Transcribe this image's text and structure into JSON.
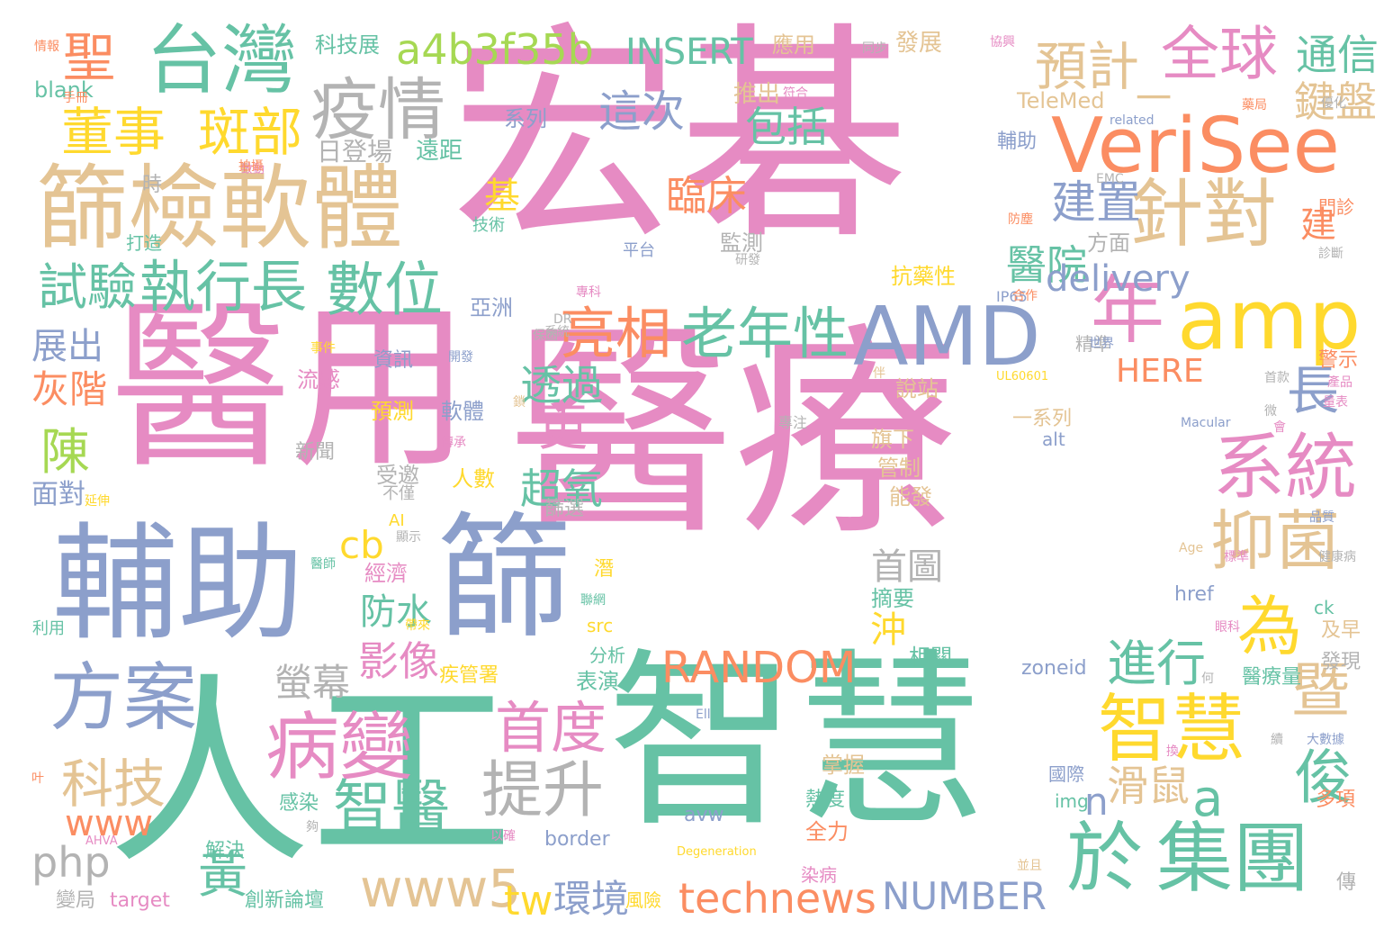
{
  "palette": {
    "pink": "#e68bc3",
    "blue": "#8c9fcb",
    "green": "#66c2a5",
    "orange": "#fb8d62",
    "tan": "#e4c494",
    "yellow": "#ffd92e",
    "lime": "#a6d853",
    "gray": "#b3b3b3"
  },
  "words": [
    {
      "text": "宏碁",
      "color": "pink"
    },
    {
      "text": "醫療",
      "color": "pink"
    },
    {
      "text": "醫用",
      "color": "pink"
    },
    {
      "text": "人工",
      "color": "green"
    },
    {
      "text": "智慧",
      "color": "green"
    },
    {
      "text": "輔助",
      "color": "blue"
    },
    {
      "text": "篩",
      "color": "blue"
    },
    {
      "text": "篩檢軟體",
      "color": "tan"
    },
    {
      "text": "台灣",
      "color": "green"
    },
    {
      "text": "疫情",
      "color": "gray"
    },
    {
      "text": "VeriSee",
      "color": "orange"
    },
    {
      "text": "amp",
      "color": "yellow"
    },
    {
      "text": "AMD",
      "color": "blue"
    },
    {
      "text": "針對",
      "color": "tan"
    },
    {
      "text": "全球",
      "color": "pink"
    },
    {
      "text": "一",
      "color": "tan"
    },
    {
      "text": "年",
      "color": "pink"
    },
    {
      "text": "系統",
      "color": "pink"
    },
    {
      "text": "抑菌",
      "color": "tan"
    },
    {
      "text": "為",
      "color": "yellow"
    },
    {
      "text": "智慧",
      "color": "yellow"
    },
    {
      "text": "暨",
      "color": "tan"
    },
    {
      "text": "於",
      "color": "green"
    },
    {
      "text": "集團",
      "color": "green"
    },
    {
      "text": "俊",
      "color": "green"
    },
    {
      "text": "方案",
      "color": "blue"
    },
    {
      "text": "病變",
      "color": "pink"
    },
    {
      "text": "智醫",
      "color": "green"
    },
    {
      "text": "首度",
      "color": "pink"
    },
    {
      "text": "提升",
      "color": "gray"
    },
    {
      "text": "科技",
      "color": "tan"
    },
    {
      "text": "www",
      "color": "orange"
    },
    {
      "text": "php",
      "color": "gray"
    },
    {
      "text": "黃",
      "color": "green"
    },
    {
      "text": "www5",
      "color": "tan"
    },
    {
      "text": "tw",
      "color": "yellow"
    },
    {
      "text": "環境",
      "color": "blue"
    },
    {
      "text": "technews",
      "color": "orange"
    },
    {
      "text": "NUMBER",
      "color": "blue"
    },
    {
      "text": "RANDOM",
      "color": "orange"
    },
    {
      "text": "螢幕",
      "color": "gray"
    },
    {
      "text": "影像",
      "color": "pink"
    },
    {
      "text": "進行",
      "color": "green"
    },
    {
      "text": "老年性",
      "color": "green"
    },
    {
      "text": "亮相",
      "color": "orange"
    },
    {
      "text": "數位",
      "color": "green"
    },
    {
      "text": "執行長",
      "color": "green"
    },
    {
      "text": "試驗",
      "color": "green"
    },
    {
      "text": "董事",
      "color": "yellow"
    },
    {
      "text": "斑部",
      "color": "yellow"
    },
    {
      "text": "聖",
      "color": "orange"
    },
    {
      "text": "a4b3f35b",
      "color": "lime"
    },
    {
      "text": "INSERT",
      "color": "green"
    },
    {
      "text": "預計",
      "color": "tan"
    },
    {
      "text": "通信",
      "color": "green"
    },
    {
      "text": "鍵盤",
      "color": "tan"
    },
    {
      "text": "包括",
      "color": "green"
    },
    {
      "text": "臨床",
      "color": "orange"
    },
    {
      "text": "這次",
      "color": "blue"
    },
    {
      "text": "建置",
      "color": "blue"
    },
    {
      "text": "醫院",
      "color": "green"
    },
    {
      "text": "delivery",
      "color": "blue"
    },
    {
      "text": "長",
      "color": "blue"
    },
    {
      "text": "HERE",
      "color": "orange"
    },
    {
      "text": "更",
      "color": "pink"
    },
    {
      "text": "透過",
      "color": "green"
    },
    {
      "text": "超氧",
      "color": "green"
    },
    {
      "text": "cb",
      "color": "yellow"
    },
    {
      "text": "防水",
      "color": "green"
    },
    {
      "text": "首圖",
      "color": "gray"
    },
    {
      "text": "沖",
      "color": "yellow"
    },
    {
      "text": "滑鼠",
      "color": "tan"
    },
    {
      "text": "n",
      "color": "blue"
    },
    {
      "text": "a",
      "color": "green"
    },
    {
      "text": "陳",
      "color": "lime"
    },
    {
      "text": "灰階",
      "color": "orange"
    },
    {
      "text": "展出",
      "color": "blue"
    },
    {
      "text": "面對",
      "color": "blue"
    },
    {
      "text": "基",
      "color": "yellow"
    },
    {
      "text": "建",
      "color": "orange"
    },
    {
      "text": "blank",
      "color": "green"
    },
    {
      "text": "TeleMed",
      "color": "tan"
    },
    {
      "text": "系列",
      "color": "blue"
    },
    {
      "text": "推出",
      "color": "tan"
    },
    {
      "text": "輔助",
      "color": "blue"
    },
    {
      "text": "科技展",
      "color": "green"
    },
    {
      "text": "應用",
      "color": "tan"
    },
    {
      "text": "發展",
      "color": "tan"
    },
    {
      "text": "日登場",
      "color": "gray"
    },
    {
      "text": "遠距",
      "color": "green"
    },
    {
      "text": "監測",
      "color": "gray"
    },
    {
      "text": "方面",
      "color": "gray"
    },
    {
      "text": "抗藥性",
      "color": "yellow"
    },
    {
      "text": "亞洲",
      "color": "blue"
    },
    {
      "text": "精準",
      "color": "gray"
    },
    {
      "text": "說站",
      "color": "tan"
    },
    {
      "text": "旗下",
      "color": "tan"
    },
    {
      "text": "管制",
      "color": "tan"
    },
    {
      "text": "能發",
      "color": "tan"
    },
    {
      "text": "一系列",
      "color": "tan"
    },
    {
      "text": "alt",
      "color": "blue"
    },
    {
      "text": "資訊",
      "color": "blue"
    },
    {
      "text": "預測",
      "color": "yellow"
    },
    {
      "text": "軟體",
      "color": "blue"
    },
    {
      "text": "流感",
      "color": "pink"
    },
    {
      "text": "新聞",
      "color": "gray"
    },
    {
      "text": "受邀",
      "color": "gray"
    },
    {
      "text": "人數",
      "color": "yellow"
    },
    {
      "text": "篩選",
      "color": "gray"
    },
    {
      "text": "經濟",
      "color": "pink"
    },
    {
      "text": "摘要",
      "color": "green"
    },
    {
      "text": "href",
      "color": "blue"
    },
    {
      "text": "ck",
      "color": "green"
    },
    {
      "text": "相關",
      "color": "green"
    },
    {
      "text": "zoneid",
      "color": "blue"
    },
    {
      "text": "醫療量",
      "color": "green"
    },
    {
      "text": "src",
      "color": "yellow"
    },
    {
      "text": "分析",
      "color": "green"
    },
    {
      "text": "疾管署",
      "color": "yellow"
    },
    {
      "text": "表演",
      "color": "green"
    },
    {
      "text": "國際",
      "color": "blue"
    },
    {
      "text": "img",
      "color": "green"
    },
    {
      "text": "多項",
      "color": "orange"
    },
    {
      "text": "掌握",
      "color": "tan"
    },
    {
      "text": "熱度",
      "color": "green"
    },
    {
      "text": "全力",
      "color": "orange"
    },
    {
      "text": "avw",
      "color": "blue"
    },
    {
      "text": "border",
      "color": "blue"
    },
    {
      "text": "染病",
      "color": "pink"
    },
    {
      "text": "風險",
      "color": "yellow"
    },
    {
      "text": "創新論壇",
      "color": "green"
    },
    {
      "text": "target",
      "color": "pink"
    },
    {
      "text": "變局",
      "color": "gray"
    },
    {
      "text": "解決",
      "color": "green"
    },
    {
      "text": "感染",
      "color": "green"
    },
    {
      "text": "發現",
      "color": "gray"
    },
    {
      "text": "及早",
      "color": "tan"
    },
    {
      "text": "警示",
      "color": "orange"
    },
    {
      "text": "門診",
      "color": "orange"
    },
    {
      "text": "打造",
      "color": "green"
    },
    {
      "text": "技術",
      "color": "green"
    },
    {
      "text": "平台",
      "color": "blue"
    },
    {
      "text": "時",
      "color": "gray"
    },
    {
      "text": "傳",
      "color": "gray"
    },
    {
      "text": "利用",
      "color": "green"
    },
    {
      "text": "AI",
      "color": "yellow"
    },
    {
      "text": "不僅",
      "color": "gray"
    },
    {
      "text": "潛",
      "color": "yellow"
    },
    {
      "text": "情報",
      "color": "orange"
    },
    {
      "text": "同步",
      "color": "gray"
    },
    {
      "text": "協興",
      "color": "pink"
    },
    {
      "text": "IP65",
      "color": "blue"
    },
    {
      "text": "related",
      "color": "blue"
    },
    {
      "text": "EMC",
      "color": "gray"
    },
    {
      "text": "研發",
      "color": "gray"
    },
    {
      "text": "專科",
      "color": "pink"
    },
    {
      "text": "診斷",
      "color": "gray"
    },
    {
      "text": "合作",
      "color": "orange"
    },
    {
      "text": "世界",
      "color": "blue"
    },
    {
      "text": "首款",
      "color": "gray"
    },
    {
      "text": "產品",
      "color": "pink"
    },
    {
      "text": "Macular",
      "color": "blue"
    },
    {
      "text": "UL60601",
      "color": "yellow"
    },
    {
      "text": "專注",
      "color": "gray"
    },
    {
      "text": "Age",
      "color": "tan"
    },
    {
      "text": "標準",
      "color": "pink"
    },
    {
      "text": "健康病",
      "color": "gray"
    },
    {
      "text": "眼科",
      "color": "pink"
    },
    {
      "text": "大數據",
      "color": "blue"
    },
    {
      "text": "Degeneration",
      "color": "yellow"
    },
    {
      "text": "以確",
      "color": "pink"
    },
    {
      "text": "AHVA",
      "color": "pink"
    },
    {
      "text": "醫師",
      "color": "green"
    },
    {
      "text": "致動",
      "color": "pink"
    },
    {
      "text": "DR",
      "color": "gray"
    },
    {
      "text": "Ell",
      "color": "blue"
    },
    {
      "text": "並且",
      "color": "tan"
    },
    {
      "text": "帶來",
      "color": "yellow"
    },
    {
      "text": "開發",
      "color": "blue"
    },
    {
      "text": "系統",
      "color": "gray"
    },
    {
      "text": "顯示",
      "color": "gray"
    },
    {
      "text": "叶",
      "color": "orange"
    },
    {
      "text": "微",
      "color": "gray"
    },
    {
      "text": "夠",
      "color": "gray"
    },
    {
      "text": "傳承",
      "color": "pink"
    },
    {
      "text": "延伸",
      "color": "yellow"
    },
    {
      "text": "藥局",
      "color": "orange"
    },
    {
      "text": "會",
      "color": "pink"
    },
    {
      "text": "伴",
      "color": "tan"
    },
    {
      "text": "何",
      "color": "gray"
    },
    {
      "text": "換",
      "color": "pink"
    },
    {
      "text": "續",
      "color": "gray"
    },
    {
      "text": "符合",
      "color": "pink"
    },
    {
      "text": "防塵",
      "color": "orange"
    },
    {
      "text": "事件",
      "color": "yellow"
    },
    {
      "text": "鎖",
      "color": "tan"
    },
    {
      "text": "聯網",
      "color": "green"
    },
    {
      "text": "量表",
      "color": "pink"
    },
    {
      "text": "拍攝",
      "color": "orange"
    },
    {
      "text": "保固",
      "color": "gray"
    },
    {
      "text": "品質",
      "color": "blue"
    },
    {
      "text": "優化",
      "color": "gray"
    },
    {
      "text": "手冊",
      "color": "orange"
    }
  ]
}
